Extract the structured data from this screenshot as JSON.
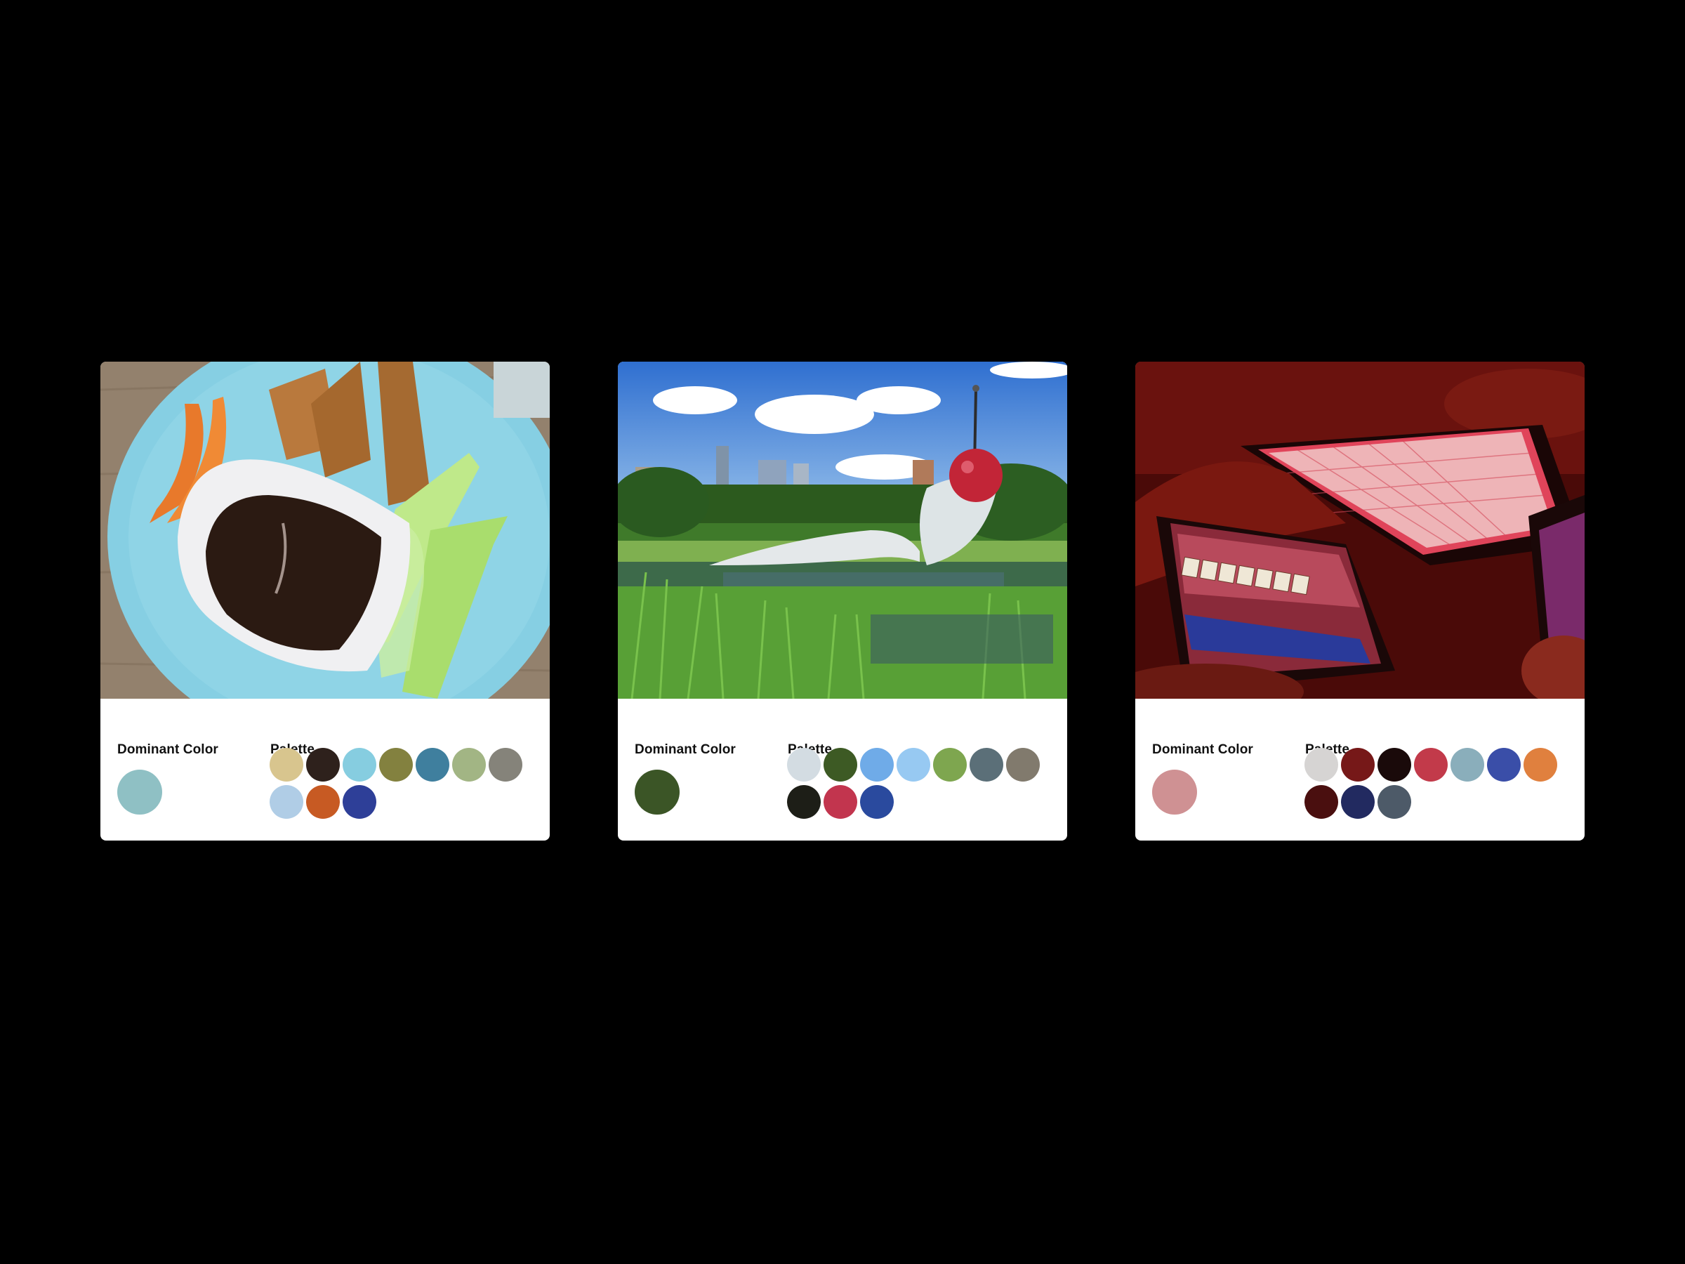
{
  "labels": {
    "dominant": "Dominant Color",
    "palette": "Palette"
  },
  "cards": [
    {
      "image_subject": "plate-with-carrots-celery-toast-and-dipping-sauce",
      "dominant_color": "#8fc0c4",
      "palette": [
        "#d8c58e",
        "#2e211c",
        "#86cde0",
        "#83813f",
        "#3f7f9e",
        "#a2b584",
        "#85837a",
        "#b0cde6",
        "#c75a23",
        "#2e3f98"
      ]
    },
    {
      "image_subject": "spoonbridge-and-cherry-sculpture-in-park",
      "dominant_color": "#3b5526",
      "palette": [
        "#d3dce2",
        "#3d5a24",
        "#6fabe8",
        "#97c9f2",
        "#7ea64f",
        "#5b6f78",
        "#817a6d",
        "#1d1e17",
        "#c2354e",
        "#2a4a9e"
      ]
    },
    {
      "image_subject": "people-playing-scrabble-on-tablets-red-light",
      "dominant_color": "#cf9193",
      "palette": [
        "#d6d4d3",
        "#761818",
        "#1a0a0a",
        "#c23a4a",
        "#8aaebb",
        "#3a4ea8",
        "#e0803e",
        "#4a0f0f",
        "#222a60",
        "#4d5a68"
      ]
    }
  ]
}
